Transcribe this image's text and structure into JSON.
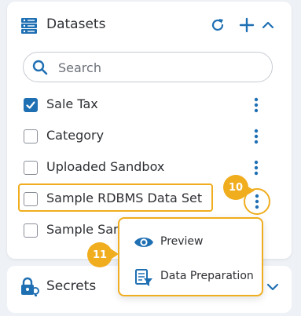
{
  "datasets_panel": {
    "title": "Datasets",
    "search": {
      "placeholder": "Search",
      "value": ""
    },
    "items": [
      {
        "label": "Sale Tax",
        "checked": true
      },
      {
        "label": "Category",
        "checked": false
      },
      {
        "label": "Uploaded Sandbox",
        "checked": false
      },
      {
        "label": "Sample RDBMS Data Set",
        "checked": false
      },
      {
        "label": "Sample Sar",
        "checked": false
      }
    ],
    "icons": [
      "database-icon",
      "refresh-icon",
      "plus-icon",
      "chevron-up-icon",
      "kebab-menu-icon"
    ]
  },
  "context_menu": {
    "items": [
      {
        "label": "Preview",
        "icon": "eye-icon"
      },
      {
        "label": "Data Preparation",
        "icon": "data-preparation-icon"
      }
    ]
  },
  "secrets_panel": {
    "title": "Secrets",
    "icons": [
      "lock-key-icon",
      "chevron-down-icon"
    ]
  },
  "callouts": {
    "step_10": "10",
    "step_11": "11"
  },
  "colors": {
    "accent_blue": "#1f6fb3",
    "highlight_orange": "#f0ad1e",
    "text": "#2d2f33",
    "background": "#eef1f6"
  }
}
